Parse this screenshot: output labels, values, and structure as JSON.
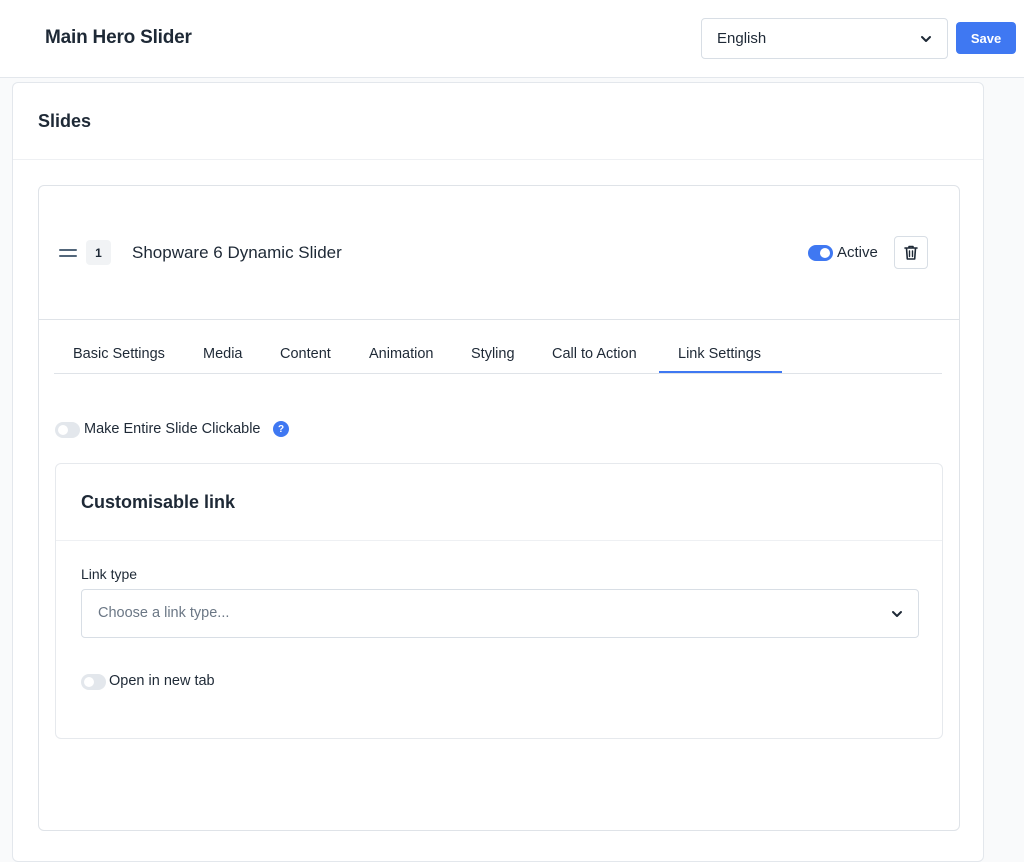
{
  "header": {
    "title": "Main Hero Slider",
    "language": {
      "selected": "English"
    },
    "save_label": "Save"
  },
  "slides_card": {
    "title": "Slides"
  },
  "slide": {
    "number": "1",
    "name": "Shopware 6 Dynamic Slider",
    "active": true,
    "active_label": "Active",
    "tabs": [
      {
        "label": "Basic Settings"
      },
      {
        "label": "Media"
      },
      {
        "label": "Content"
      },
      {
        "label": "Animation"
      },
      {
        "label": "Styling"
      },
      {
        "label": "Call to Action"
      },
      {
        "label": "Link Settings",
        "selected": true
      }
    ],
    "link_settings": {
      "make_clickable_label": "Make Entire Slide Clickable",
      "make_clickable_enabled": false,
      "help_symbol": "?",
      "customisable_link": {
        "title": "Customisable link",
        "link_type_label": "Link type",
        "link_type_placeholder": "Choose a link type...",
        "open_new_tab_label": "Open in new tab",
        "open_new_tab_enabled": false
      }
    }
  },
  "colors": {
    "accent": "#3f78f2",
    "text": "#1e2936",
    "border": "#d8dee5",
    "toggle_off": "#e3e7ec"
  },
  "icons": [
    "chevron-down-icon",
    "drag-handle-icon",
    "trash-icon",
    "help-icon"
  ]
}
